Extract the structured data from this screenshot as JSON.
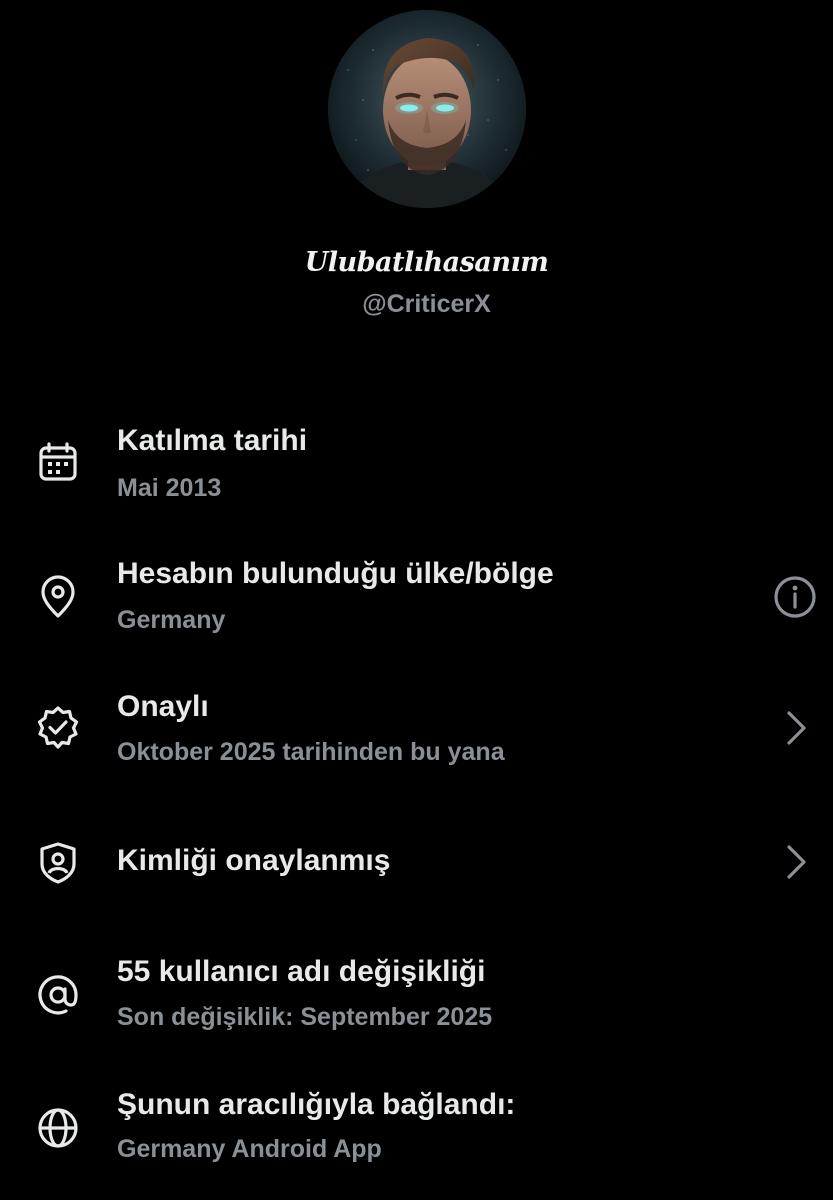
{
  "profile": {
    "display_name": "Ulubatlıhasanım",
    "handle": "@CriticerX"
  },
  "info_rows": [
    {
      "icon": "calendar-icon",
      "title": "Katılma tarihi",
      "subtitle": "Mai 2013",
      "trailing": null
    },
    {
      "icon": "location-pin-icon",
      "title": "Hesabın bulunduğu ülke/bölge",
      "subtitle": "Germany",
      "trailing": "info-icon"
    },
    {
      "icon": "verified-badge-icon",
      "title": "Onaylı",
      "subtitle": "Oktober 2025 tarihinden bu yana",
      "trailing": "chevron-right-icon"
    },
    {
      "icon": "id-shield-icon",
      "title": "Kimliği onaylanmış",
      "subtitle": null,
      "trailing": "chevron-right-icon"
    },
    {
      "icon": "at-sign-icon",
      "title": "55 kullanıcı adı değişikliği",
      "subtitle": "Son değişiklik: September 2025",
      "trailing": null
    },
    {
      "icon": "globe-icon",
      "title": "Şunun aracılığıyla bağlandı:",
      "subtitle": "Germany Android App",
      "trailing": null
    }
  ],
  "colors": {
    "background": "#000000",
    "primary_text": "#e7e9ea",
    "secondary_text": "#8b9097",
    "icon": "#e7e9ea",
    "trailing_icon": "#8b9097"
  }
}
